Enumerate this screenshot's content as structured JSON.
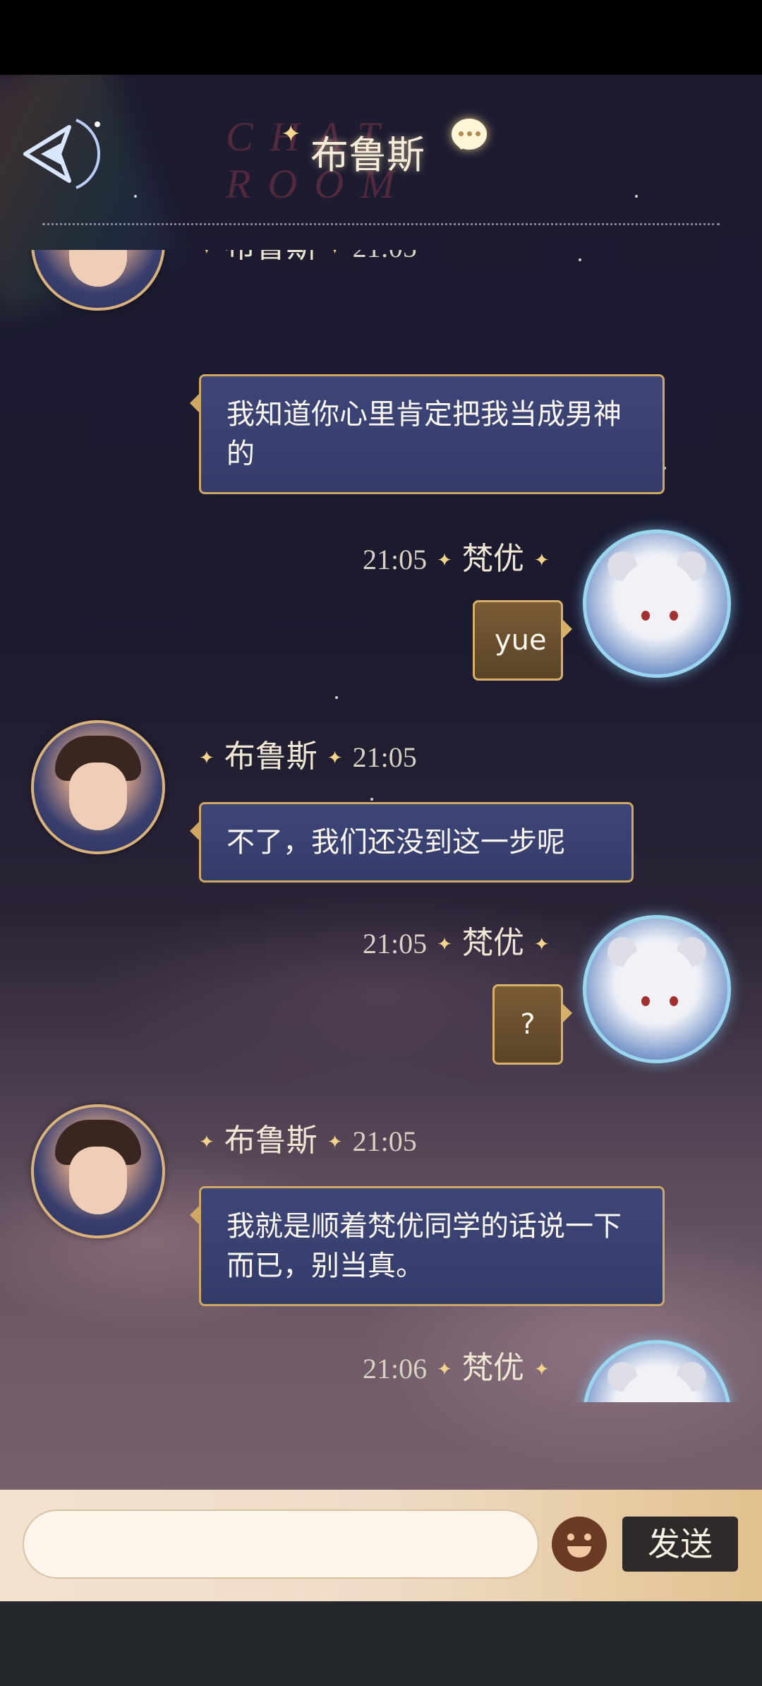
{
  "header": {
    "title": "布鲁斯",
    "watermark": "CHAT ROOM"
  },
  "messages": [
    {
      "sender": "布鲁斯",
      "time": "21:05",
      "text": "我知道你心里肯定把我当成男神的"
    },
    {
      "sender": "梵优",
      "time": "21:05",
      "text": "yue"
    },
    {
      "sender": "布鲁斯",
      "time": "21:05",
      "text": "不了，我们还没到这一步呢"
    },
    {
      "sender": "梵优",
      "time": "21:05",
      "text": "?"
    },
    {
      "sender": "布鲁斯",
      "time": "21:05",
      "text": "我就是顺着梵优同学的话说一下而已，别当真。"
    },
    {
      "sender": "梵优",
      "time": "21:06",
      "text": "。。。。。"
    }
  ],
  "input": {
    "value": "",
    "placeholder": "",
    "send_label": "发送"
  },
  "colors": {
    "left_bubble": "#3d4677",
    "right_bubble": "#7a5c36",
    "bubble_border": "#cfa760",
    "send_button": "#2e2a2a"
  }
}
